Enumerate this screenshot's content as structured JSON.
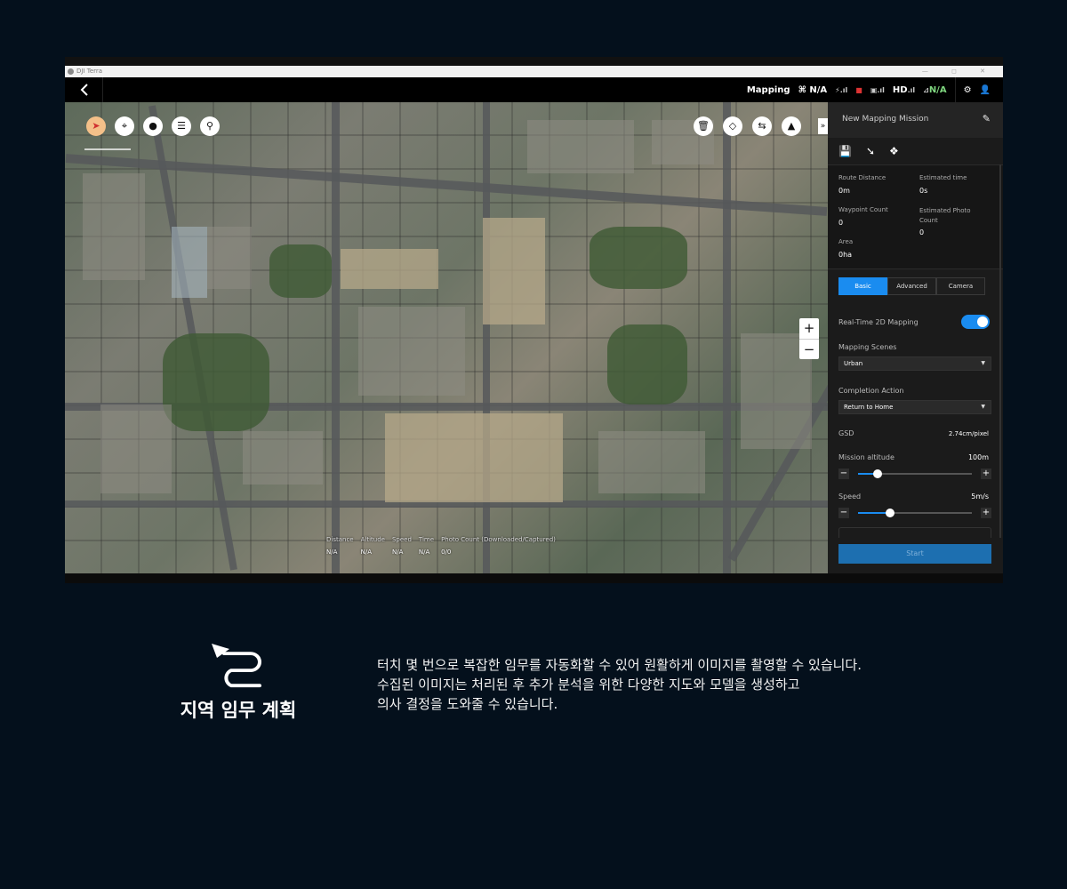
{
  "window": {
    "title": "DJI Terra",
    "controls": "— ◻ ✕"
  },
  "statusbar": {
    "back_icon": "chevron-left-icon",
    "mode": "Mapping",
    "gps": "N/A",
    "hd_label": "HD",
    "rtk": "N/A"
  },
  "map": {
    "telemetry": {
      "labels": [
        "Distance",
        "Altitude",
        "Speed",
        "Time",
        "Photo Count (Downloaded/Captured)"
      ],
      "values": [
        "N/A",
        "N/A",
        "N/A",
        "N/A",
        "0/0"
      ]
    },
    "zoom_in": "+",
    "zoom_out": "−",
    "collapse": "»"
  },
  "panel": {
    "title": "New Mapping Mission",
    "stats": {
      "route_distance_label": "Route Distance",
      "route_distance": "0m",
      "estimated_time_label": "Estimated time",
      "estimated_time": "0s",
      "waypoint_count_label": "Waypoint Count",
      "waypoint_count": "0",
      "estimated_photo_label": "Estimated Photo Count",
      "estimated_photo": "0",
      "area_label": "Area",
      "area": "0ha"
    },
    "tabs": [
      "Basic",
      "Advanced",
      "Camera"
    ],
    "realtime_label": "Real-Time 2D Mapping",
    "realtime_on": true,
    "scenes_label": "Mapping Scenes",
    "scenes_value": "Urban",
    "completion_label": "Completion Action",
    "completion_value": "Return to Home",
    "gsd_label": "GSD",
    "gsd_value": "2.74cm/pixel",
    "altitude_label": "Mission altitude",
    "altitude_value": "100m",
    "altitude_fraction": 0.17,
    "speed_label": "Speed",
    "speed_value": "5m/s",
    "speed_fraction": 0.28,
    "start_label": "Start"
  },
  "caption": {
    "title": "지역 임무 계획",
    "lines": [
      "터치 몇 번으로 복잡한 임무를 자동화할 수 있어 원활하게 이미지를 촬영할 수 있습니다.",
      "수집된 이미지는 처리된 후 추가 분석을 위한 다양한 지도와 모델을 생성하고",
      "의사 결정을 도와줄 수 있습니다."
    ]
  },
  "colors": {
    "accent": "#1a8cf0",
    "background": "#04101c",
    "panel": "#1b1b1b"
  }
}
